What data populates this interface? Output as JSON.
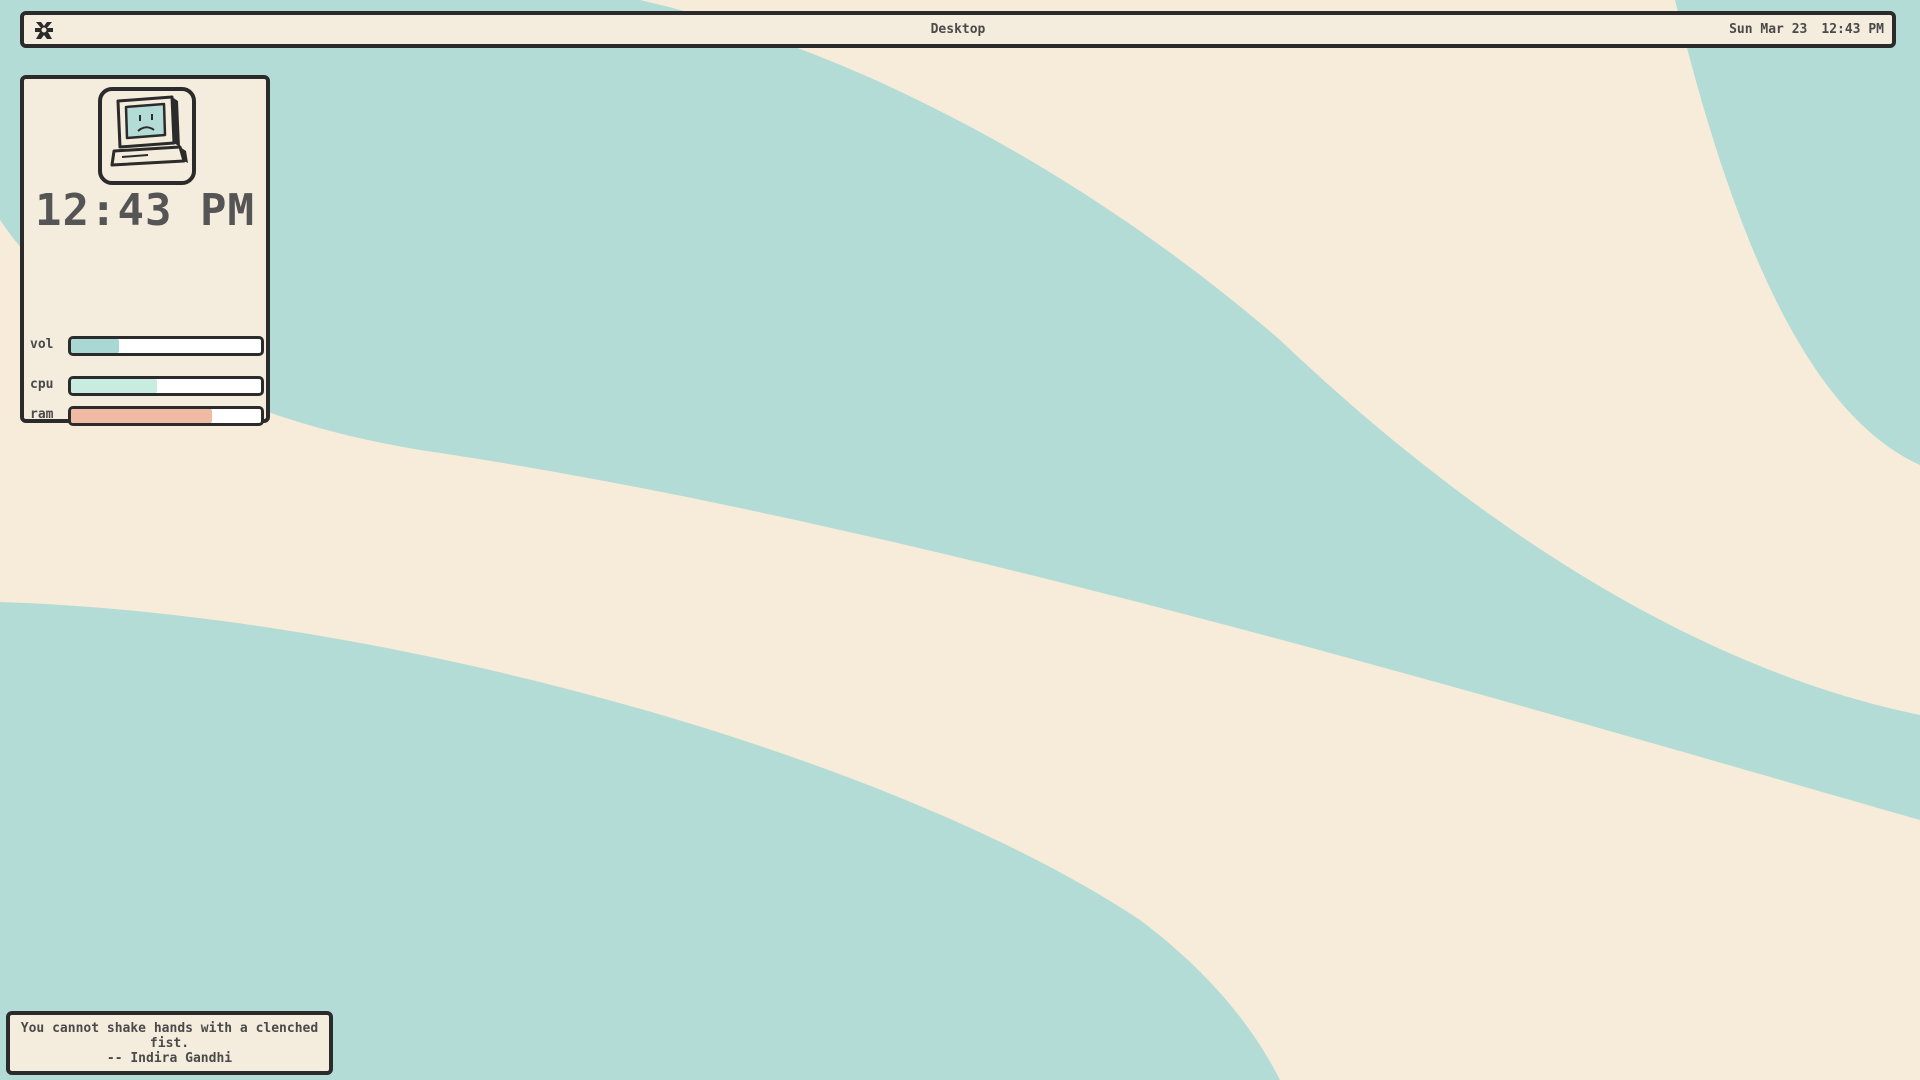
{
  "desktop": {
    "wallpaper": {
      "colors": {
        "cream": "#f6ecd9",
        "teal": "#b4dcd6"
      }
    }
  },
  "topbar": {
    "logo_icon": "puzzle-logo-icon",
    "title": "Desktop",
    "date": "Sun Mar 23",
    "time": "12:43 PM"
  },
  "widget": {
    "avatar_icon": "sad-computer-icon",
    "clock": "12:43 PM",
    "meters": {
      "vol": {
        "label": "vol",
        "level": 0.25,
        "color": "#a9d7d4"
      },
      "cpu": {
        "label": "cpu",
        "level": 0.45,
        "color": "#c9ece1"
      },
      "ram": {
        "label": "ram",
        "level": 0.74,
        "color": "#efbba4"
      }
    }
  },
  "quote": {
    "text": "You cannot shake hands with a clenched fist.",
    "author": "-- Indira Gandhi"
  }
}
